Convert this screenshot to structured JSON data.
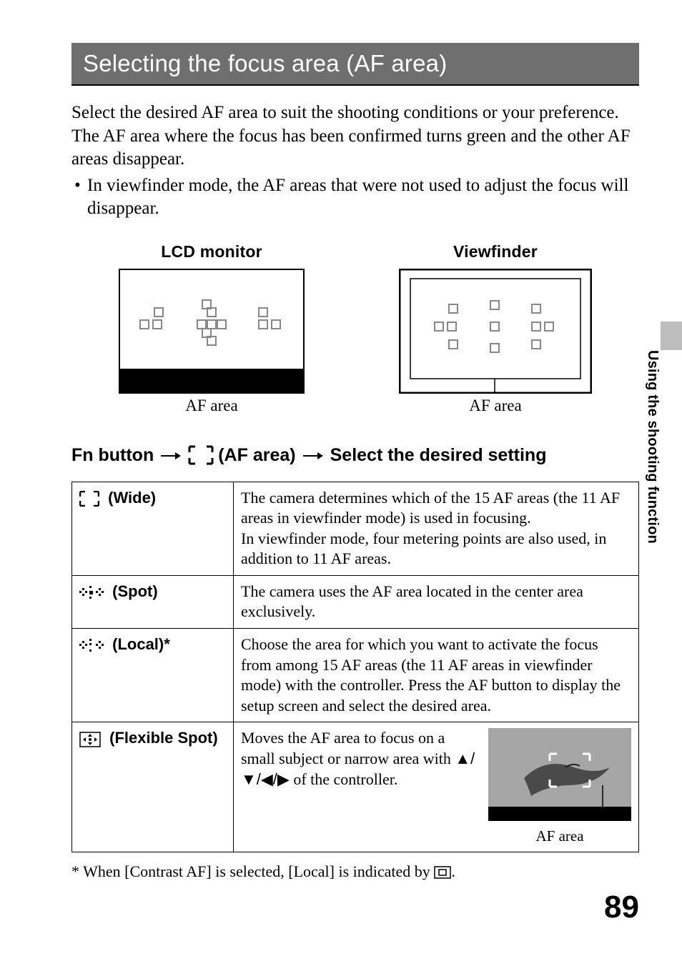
{
  "section_title": "Selecting the focus area (AF area)",
  "intro_para": "Select the desired AF area to suit the shooting conditions or your preference. The AF area where the focus has been confirmed turns green and the other AF areas disappear.",
  "intro_bullet": "In viewfinder mode, the AF areas that were not used to adjust the focus will disappear.",
  "monitors": {
    "lcd_caption": "LCD monitor",
    "viewfinder_caption": "Viewfinder",
    "af_area_label": "AF area"
  },
  "fn_line": {
    "prefix": "Fn button",
    "af_area_text": "(AF area)",
    "suffix": "Select the desired setting"
  },
  "table": {
    "wide": {
      "label": "(Wide)",
      "desc": "The camera determines which of the 15 AF areas (the 11 AF areas in viewfinder mode) is used in focusing.\nIn viewfinder mode, four metering points are also used, in addition to 11 AF areas."
    },
    "spot": {
      "label": "(Spot)",
      "desc": "The camera uses the AF area located in the center area exclusively."
    },
    "local": {
      "label": "(Local)*",
      "desc": "Choose the area for which you want to activate the focus from among 15 AF areas (the 11 AF areas in viewfinder mode) with the controller. Press the AF button to display the setup screen and select the desired area."
    },
    "flexible": {
      "label": "(Flexible Spot)",
      "desc_before": "Moves the AF area to focus on a small subject or narrow area with ",
      "desc_after": " of the controller.",
      "img_label": "AF area"
    }
  },
  "footnote_before": "* When [Contrast AF] is selected, [Local] is indicated by ",
  "footnote_after": ".",
  "side_tab": "Using the shooting function",
  "page_number": "89"
}
